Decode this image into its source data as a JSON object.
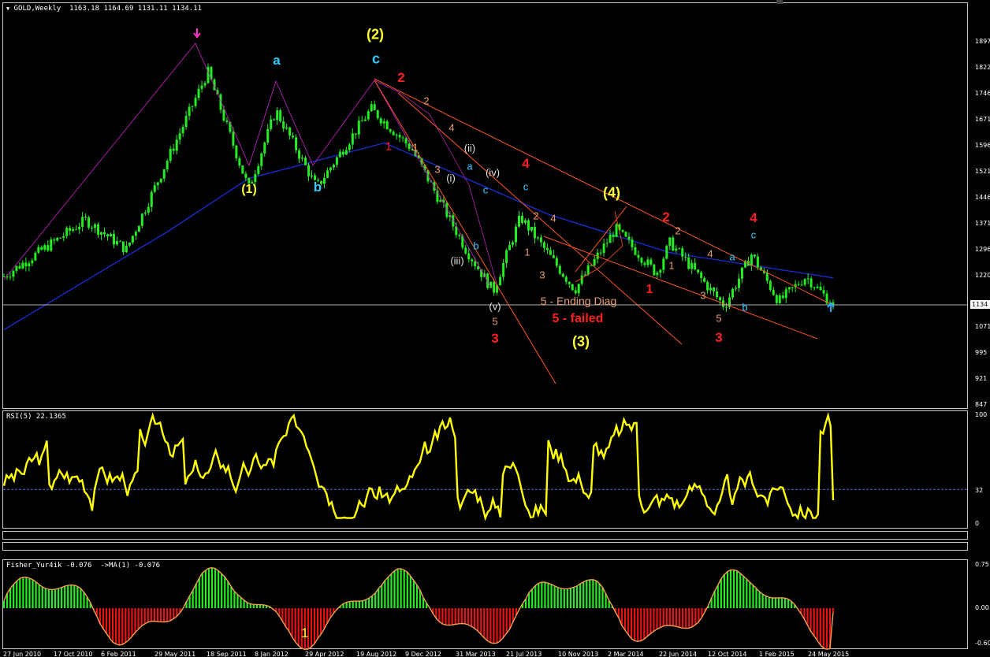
{
  "header": {
    "symbol_label": "GOLD,Weekly",
    "ohlc": "1163.18 1164.69 1131.11 1134.11"
  },
  "price_axis": {
    "ticks": [
      "1897",
      "1822",
      "1746",
      "1671",
      "1596",
      "1521",
      "1446",
      "1371",
      "1296",
      "1220",
      "1071",
      "995",
      "921",
      "847"
    ],
    "current_price": "1134"
  },
  "rsi": {
    "label": "RSI(5) 22.1365",
    "axis": [
      "100",
      "32",
      "0"
    ],
    "level": 32
  },
  "fisher": {
    "label": "Fisher_Yur4ik -0.076  ->MA(1) -0.076",
    "axis": [
      "0.75",
      "0.00",
      "-0.60"
    ],
    "bottom_label": "1"
  },
  "time_axis": [
    "27 Jun 2010",
    "17 Oct 2010",
    "6 Feb 2011",
    "29 May 2011",
    "18 Sep 2011",
    "8 Jan 2012",
    "29 Apr 2012",
    "19 Aug 2012",
    "9 Dec 2012",
    "31 Mar 2013",
    "21 Jul 2013",
    "10 Nov 2013",
    "2 Mar 2014",
    "22 Jun 2014",
    "12 Oct 2014",
    "1 Feb 2015",
    "24 May 2015"
  ],
  "wave_labels": [
    {
      "text": "(2)",
      "color": "#ffff33",
      "size": 18
    },
    {
      "text": "c",
      "color": "#33ccff",
      "size": 18
    },
    {
      "text": "a",
      "color": "#33ccff",
      "size": 17
    },
    {
      "text": "(1)",
      "color": "#ffff33",
      "size": 16
    },
    {
      "text": "b",
      "color": "#33ccff",
      "size": 17
    },
    {
      "text": "2",
      "color": "#ff2020",
      "size": 17
    },
    {
      "text": "1",
      "color": "#ff2020",
      "size": 15
    },
    {
      "text": "2",
      "color": "#e8a070",
      "size": 13
    },
    {
      "text": "4",
      "color": "#e8a070",
      "size": 13
    },
    {
      "text": "1",
      "color": "#e8a070",
      "size": 13
    },
    {
      "text": "3",
      "color": "#e8a070",
      "size": 13
    },
    {
      "text": "(ii)",
      "color": "#e0e0e0",
      "size": 13
    },
    {
      "text": "a",
      "color": "#33ccff",
      "size": 13
    },
    {
      "text": "(i)",
      "color": "#e0e0e0",
      "size": 13
    },
    {
      "text": "(iv)",
      "color": "#e0e0e0",
      "size": 13
    },
    {
      "text": "c",
      "color": "#33ccff",
      "size": 13
    },
    {
      "text": "4",
      "color": "#ff2020",
      "size": 17
    },
    {
      "text": "c",
      "color": "#33ccff",
      "size": 13
    },
    {
      "text": "2",
      "color": "#e8a070",
      "size": 13
    },
    {
      "text": "4",
      "color": "#e8a070",
      "size": 13
    },
    {
      "text": "b",
      "color": "#33ccff",
      "size": 13
    },
    {
      "text": "(iii)",
      "color": "#e0e0e0",
      "size": 13
    },
    {
      "text": "1",
      "color": "#e8a070",
      "size": 13
    },
    {
      "text": "3",
      "color": "#e8a070",
      "size": 13
    },
    {
      "text": "(v)",
      "color": "#e0e0e0",
      "size": 13
    },
    {
      "text": "5",
      "color": "#e8a070",
      "size": 13
    },
    {
      "text": "3",
      "color": "#ff2020",
      "size": 17
    },
    {
      "text": "(4)",
      "color": "#ffff33",
      "size": 18
    },
    {
      "text": "5 - Ending Diag",
      "color": "#e8a070",
      "size": 14
    },
    {
      "text": "5 - failed",
      "color": "#ff2020",
      "size": 16
    },
    {
      "text": "(3)",
      "color": "#ffff33",
      "size": 18
    },
    {
      "text": "2",
      "color": "#ff2020",
      "size": 17
    },
    {
      "text": "2",
      "color": "#e8a070",
      "size": 13
    },
    {
      "text": "1",
      "color": "#e8a070",
      "size": 13
    },
    {
      "text": "1",
      "color": "#ff2020",
      "size": 16
    },
    {
      "text": "4",
      "color": "#e8a070",
      "size": 13
    },
    {
      "text": "a",
      "color": "#33ccff",
      "size": 13
    },
    {
      "text": "3",
      "color": "#e8a070",
      "size": 13
    },
    {
      "text": "5",
      "color": "#e8a070",
      "size": 13
    },
    {
      "text": "3",
      "color": "#ff2020",
      "size": 17
    },
    {
      "text": "4",
      "color": "#ff2020",
      "size": 17
    },
    {
      "text": "c",
      "color": "#33ccff",
      "size": 13
    },
    {
      "text": "b",
      "color": "#33ccff",
      "size": 13
    }
  ],
  "chart_data": {
    "type": "line",
    "title": "GOLD,Weekly",
    "colors": {
      "candles": "#22ee22",
      "ma": "#1a2ed8",
      "rsi": "#ffff00",
      "fisher_pos": "#22ee22",
      "fisher_neg": "#ee1111",
      "fisher_ma": "#f0a050",
      "trendlines": "#ff5522",
      "waves": "#cc22cc"
    },
    "price_swings": [
      {
        "date": "Jun 2010",
        "price": 1230
      },
      {
        "date": "Dec 2010",
        "price": 1420
      },
      {
        "date": "Mar 2011",
        "price": 1320
      },
      {
        "date": "Sep 2011",
        "price": 1920
      },
      {
        "date": "Dec 2011",
        "price": 1525
      },
      {
        "date": "Feb 2012",
        "price": 1790
      },
      {
        "date": "May 2012",
        "price": 1530
      },
      {
        "date": "Sep 2012",
        "price": 1795
      },
      {
        "date": "Dec 2012",
        "price": 1660
      },
      {
        "date": "Apr 2013",
        "price": 1320
      },
      {
        "date": "Jun 2013",
        "price": 1180
      },
      {
        "date": "Aug 2013",
        "price": 1430
      },
      {
        "date": "Dec 2013",
        "price": 1185
      },
      {
        "date": "Mar 2014",
        "price": 1390
      },
      {
        "date": "Jun 2014",
        "price": 1240
      },
      {
        "date": "Jul 2014",
        "price": 1345
      },
      {
        "date": "Nov 2014",
        "price": 1130
      },
      {
        "date": "Jan 2015",
        "price": 1305
      },
      {
        "date": "Mar 2015",
        "price": 1145
      },
      {
        "date": "May 2015",
        "price": 1230
      },
      {
        "date": "Jul 2015",
        "price": 1134
      }
    ],
    "ma_level_points": [
      {
        "date": "Jun 2010",
        "price": 1050
      },
      {
        "date": "Jun 2011",
        "price": 1380
      },
      {
        "date": "Dec 2011",
        "price": 1560
      },
      {
        "date": "Oct 2012",
        "price": 1680
      },
      {
        "date": "Oct 2013",
        "price": 1440
      },
      {
        "date": "Jul 2014",
        "price": 1310
      },
      {
        "date": "Jul 2015",
        "price": 1225
      }
    ],
    "current_price": 1134.11,
    "rsi_period": 5,
    "rsi_value": 22.1365,
    "fisher_value": -0.076
  }
}
